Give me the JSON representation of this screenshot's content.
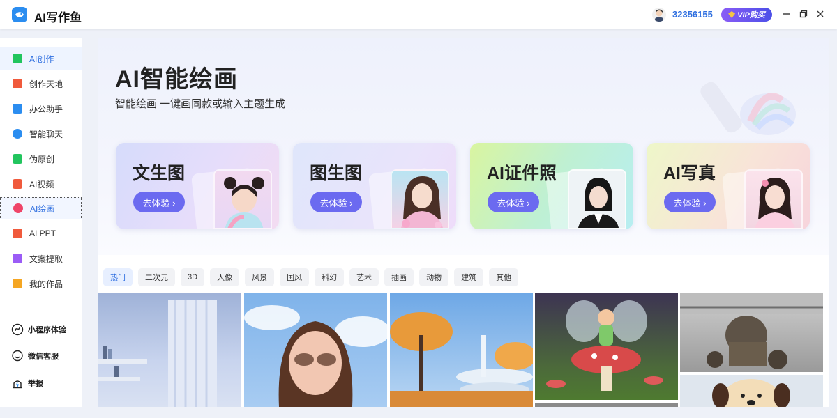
{
  "app": {
    "title": "AI写作鱼"
  },
  "header": {
    "user_id": "32356155",
    "vip_label": "VIP购买"
  },
  "window_controls": [
    "minimize-icon",
    "restore-icon",
    "close-icon"
  ],
  "sidebar": {
    "items": [
      {
        "label": "AI创作",
        "icon": "ai-create-icon",
        "color": "#22c55e"
      },
      {
        "label": "创作天地",
        "icon": "pen-icon",
        "color": "#f05a3c"
      },
      {
        "label": "办公助手",
        "icon": "briefcase-icon",
        "color": "#2b8df0"
      },
      {
        "label": "智能聊天",
        "icon": "chat-icon",
        "color": "#2b8df0"
      },
      {
        "label": "伪原创",
        "icon": "t-icon",
        "color": "#22c55e"
      },
      {
        "label": "AI视频",
        "icon": "video-icon",
        "color": "#f05a3c"
      },
      {
        "label": "AI绘画",
        "icon": "palette-icon",
        "color": "#ef4468"
      },
      {
        "label": "AI PPT",
        "icon": "ppt-icon",
        "color": "#f05a3c"
      },
      {
        "label": "文案提取",
        "icon": "extract-icon",
        "color": "#9b5cf6"
      },
      {
        "label": "我的作品",
        "icon": "folder-icon",
        "color": "#f5a623"
      }
    ],
    "bottom": [
      {
        "label": "小程序体验",
        "icon": "mini-program-icon"
      },
      {
        "label": "微信客服",
        "icon": "service-icon"
      },
      {
        "label": "举报",
        "icon": "report-icon"
      }
    ]
  },
  "hero": {
    "title": "AI智能绘画",
    "subtitle": "智能绘画 一键画同款或输入主题生成"
  },
  "cards": [
    {
      "title": "文生图",
      "button": "去体验 ›"
    },
    {
      "title": "图生图",
      "button": "去体验 ›"
    },
    {
      "title": "AI证件照",
      "button": "去体验 ›"
    },
    {
      "title": "AI写真",
      "button": "去体验 ›"
    }
  ],
  "tags": [
    "热门",
    "二次元",
    "3D",
    "人像",
    "风景",
    "国风",
    "科幻",
    "艺术",
    "插画",
    "动物",
    "建筑",
    "其他"
  ],
  "active_tag": "热门",
  "gallery": [
    {
      "subject": "bedroom-interior"
    },
    {
      "subject": "girl-with-sunglasses"
    },
    {
      "subject": "futuristic-architecture-trees"
    },
    {
      "subject": "fairy-on-mushroom"
    },
    {
      "subject": "steampunk-robot"
    },
    {
      "subject": "cartoon-dog"
    }
  ],
  "colors": {
    "accent": "#2f6fe0",
    "button": "#6b6af0",
    "vip_start": "#8a5cf6",
    "vip_end": "#4b4fe8"
  }
}
